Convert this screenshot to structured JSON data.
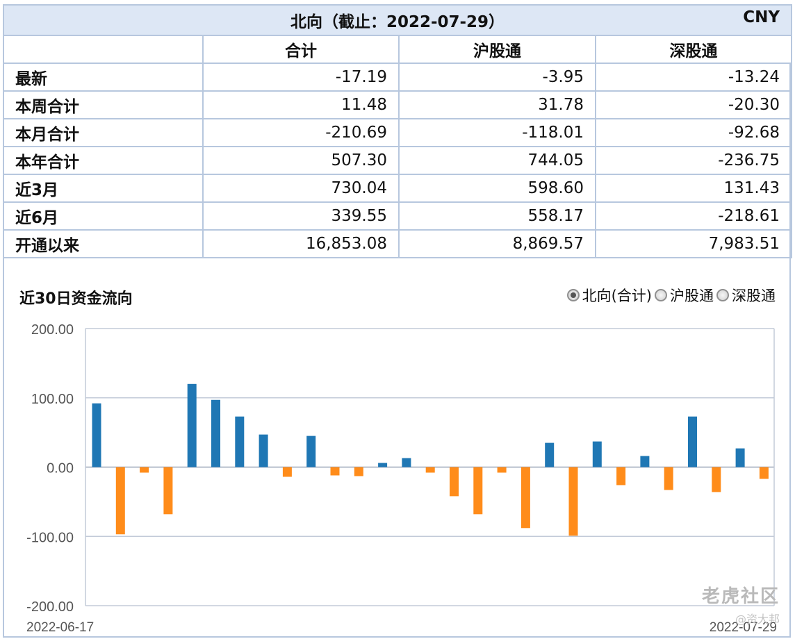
{
  "table": {
    "title": "北向（截止：2022-07-29）",
    "currency": "CNY",
    "columns": [
      "",
      "合计",
      "沪股通",
      "深股通"
    ],
    "rows": [
      {
        "label": "最新",
        "values": [
          "-17.19",
          "-3.95",
          "-13.24"
        ]
      },
      {
        "label": "本周合计",
        "values": [
          "11.48",
          "31.78",
          "-20.30"
        ]
      },
      {
        "label": "本月合计",
        "values": [
          "-210.69",
          "-118.01",
          "-92.68"
        ]
      },
      {
        "label": "本年合计",
        "values": [
          "507.30",
          "744.05",
          "-236.75"
        ]
      },
      {
        "label": "近3月",
        "values": [
          "730.04",
          "598.60",
          "131.43"
        ]
      },
      {
        "label": "近6月",
        "values": [
          "339.55",
          "558.17",
          "-218.61"
        ]
      },
      {
        "label": "开通以来",
        "values": [
          "16,853.08",
          "8,869.57",
          "7,983.51"
        ]
      }
    ]
  },
  "legend": {
    "options": [
      {
        "label": "北向(合计)",
        "checked": true
      },
      {
        "label": "沪股通",
        "checked": false
      },
      {
        "label": "深股通",
        "checked": false
      }
    ]
  },
  "watermark": {
    "main": "老虎社区",
    "sub": "@资大邦"
  },
  "chart_data": {
    "type": "bar",
    "title": "近30日资金流向",
    "ylim": [
      -200,
      200
    ],
    "yticks": [
      "200.00",
      "100.00",
      "0.00",
      "-100.00",
      "-200.00"
    ],
    "x_start_label": "2022-06-17",
    "x_end_label": "2022-07-29",
    "grid": true,
    "colors": {
      "positive": "#1f77b4",
      "negative": "#ff8c1a"
    },
    "values": [
      92,
      -97,
      -8,
      -68,
      120,
      97,
      73,
      47,
      -14,
      45,
      -12,
      -13,
      6,
      13,
      -8,
      -42,
      -68,
      -8,
      -88,
      35,
      -99,
      37,
      -26,
      16,
      -33,
      73,
      -36,
      27,
      -17
    ]
  }
}
